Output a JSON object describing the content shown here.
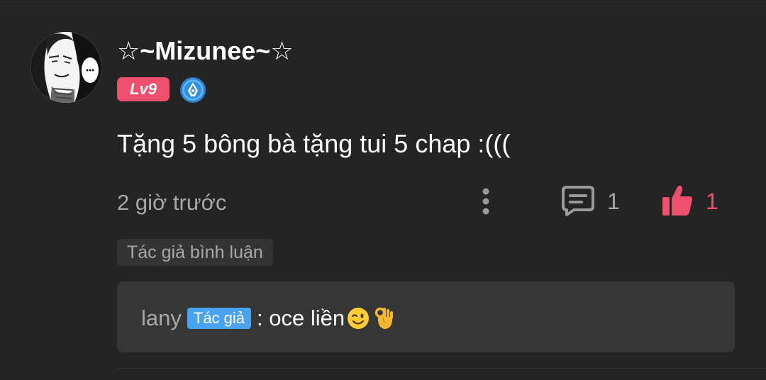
{
  "comment": {
    "username": "☆~Mizunee~☆",
    "level": "Lv9",
    "text": "Tặng 5 bông bà tặng tui 5 chap :(((",
    "timestamp": "2 giờ trước",
    "reply_count": "1",
    "like_count": "1",
    "author_tag": "Tác giả bình luận"
  },
  "reply": {
    "author": "lany",
    "badge": "Tác giả",
    "text": ": oce liền",
    "emojis": [
      "winking-face-icon",
      "ok-hand-icon"
    ]
  },
  "icons": {
    "avatar": "manga-avatar",
    "badge": "pen-nib-badge-icon",
    "more": "more-vertical-icon",
    "reply": "comment-icon",
    "like": "thumbs-up-icon"
  },
  "colors": {
    "background": "#242424",
    "accent_pink": "#f0506e",
    "accent_blue": "#4aa3f0",
    "muted_text": "#a8a8a8"
  }
}
